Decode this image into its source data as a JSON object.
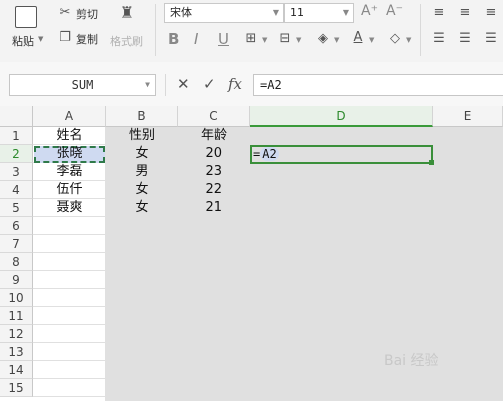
{
  "ribbon": {
    "paste_label": "粘贴",
    "cut_label": "剪切",
    "copy_label": "复制",
    "format_painter_label": "格式刷",
    "font_name": "宋体",
    "font_size": "11",
    "increase_font": "A⁺",
    "decrease_font": "A⁻",
    "bold": "B",
    "italic": "I",
    "underline": "U"
  },
  "formula_bar": {
    "name_box": "SUM",
    "cancel": "✕",
    "enter": "✓",
    "fx": "fx",
    "formula": "=A2"
  },
  "columns": [
    "A",
    "B",
    "C",
    "D",
    "E"
  ],
  "rows": [
    "1",
    "2",
    "3",
    "4",
    "5",
    "6",
    "7",
    "8",
    "9",
    "10",
    "11",
    "12",
    "13",
    "14",
    "15"
  ],
  "cells": {
    "A1": "姓名",
    "B1": "性别",
    "C1": "年龄",
    "A2": "张晓",
    "B2": "女",
    "C2": "20",
    "A3": "李磊",
    "B3": "男",
    "C3": "23",
    "A4": "伍仟",
    "B4": "女",
    "C4": "22",
    "A5": "聂爽",
    "B5": "女",
    "C5": "21"
  },
  "active_cell_formula": {
    "prefix": "=",
    "ref": "A2"
  },
  "watermark": "Bai 经验",
  "colors": {
    "active_green": "#3a9a3a",
    "ref_highlight": "#cfdaf1"
  }
}
